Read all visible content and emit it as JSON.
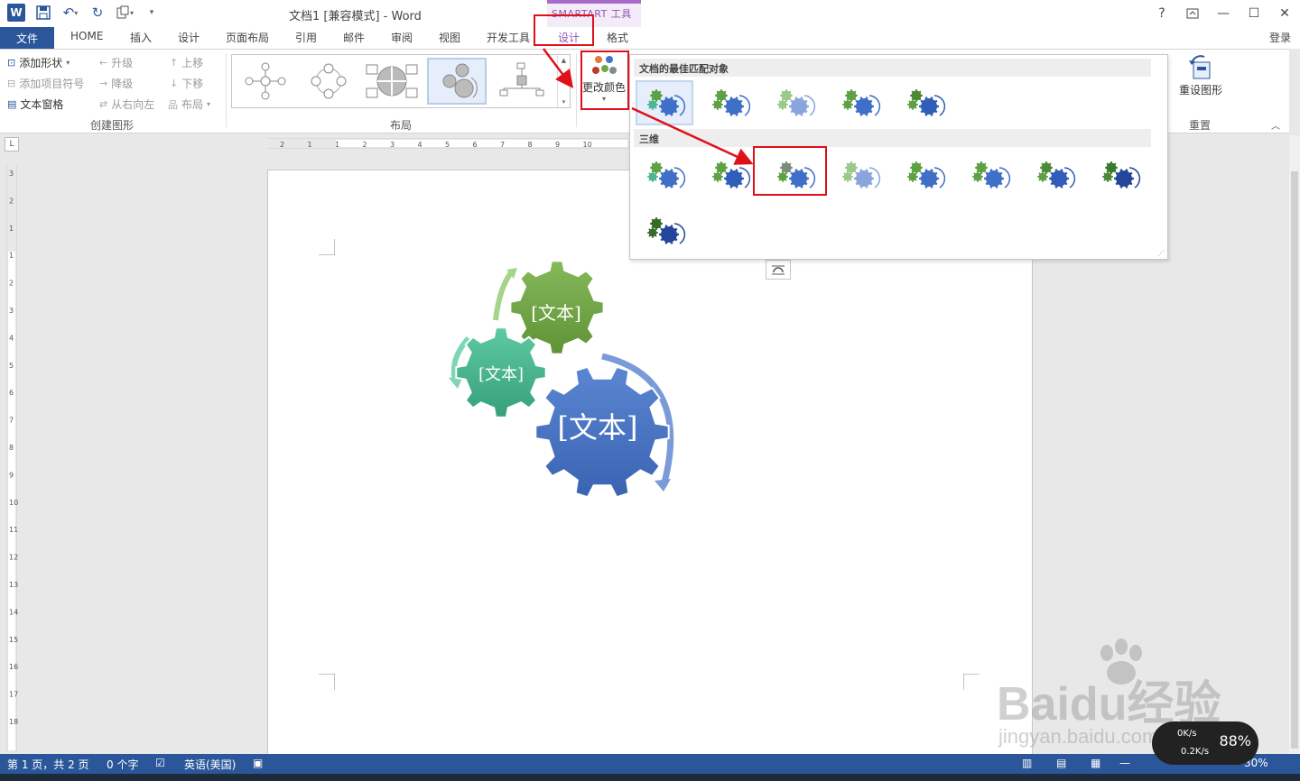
{
  "window": {
    "title": "文档1 [兼容模式] - Word",
    "context_tab_group": "SMARTART 工具",
    "login": "登录"
  },
  "tabs": {
    "file": "文件",
    "home": "HOME",
    "insert": "插入",
    "design1": "设计",
    "page_layout": "页面布局",
    "references": "引用",
    "mailings": "邮件",
    "review": "审阅",
    "view": "视图",
    "developer": "开发工具",
    "smart_design": "设计",
    "format": "格式"
  },
  "ribbon": {
    "create_graphic": {
      "add_shape": "添加形状",
      "add_bullet": "添加项目符号",
      "text_pane": "文本窗格",
      "promote": "升级",
      "demote": "降级",
      "right_to_left": "从右向左",
      "move_up": "上移",
      "move_down": "下移",
      "layout": "布局",
      "group_label": "创建图形"
    },
    "layouts": {
      "group_label": "布局"
    },
    "change_colors": "更改颜色",
    "reset": {
      "button": "重设图形",
      "group_label": "重置"
    }
  },
  "dropdown": {
    "section1": "文档的最佳匹配对象",
    "section2": "三维"
  },
  "smartart": {
    "gear1": "[文本]",
    "gear2": "[文本]",
    "gear3": "[文本]"
  },
  "ruler": {
    "h_labels": [
      "2",
      "1",
      "1",
      "2",
      "3",
      "4",
      "5",
      "6",
      "7",
      "8",
      "9",
      "10"
    ],
    "v_labels": [
      "3",
      "2",
      "1",
      "1",
      "2",
      "3",
      "4",
      "5",
      "6",
      "7",
      "8",
      "9",
      "10",
      "11",
      "12",
      "13",
      "14",
      "15",
      "16",
      "17",
      "18"
    ]
  },
  "status": {
    "page": "第 1 页，共 2 页",
    "words": "0 个字",
    "language": "英语(美国)",
    "zoom": "30%"
  },
  "speed": {
    "up": "0K/s",
    "down": "0.2K/s",
    "percent": "88%"
  },
  "watermark": {
    "main": "Baidu经验",
    "sub": "jingyan.baidu.com"
  },
  "colors": {
    "word_blue": "#2b579a",
    "smartart_purple": "#8f55b5",
    "gear_green": "#71a845",
    "gear_teal": "#4ab88f",
    "gear_blue": "#4472c4",
    "annotation_red": "#e0101a"
  }
}
